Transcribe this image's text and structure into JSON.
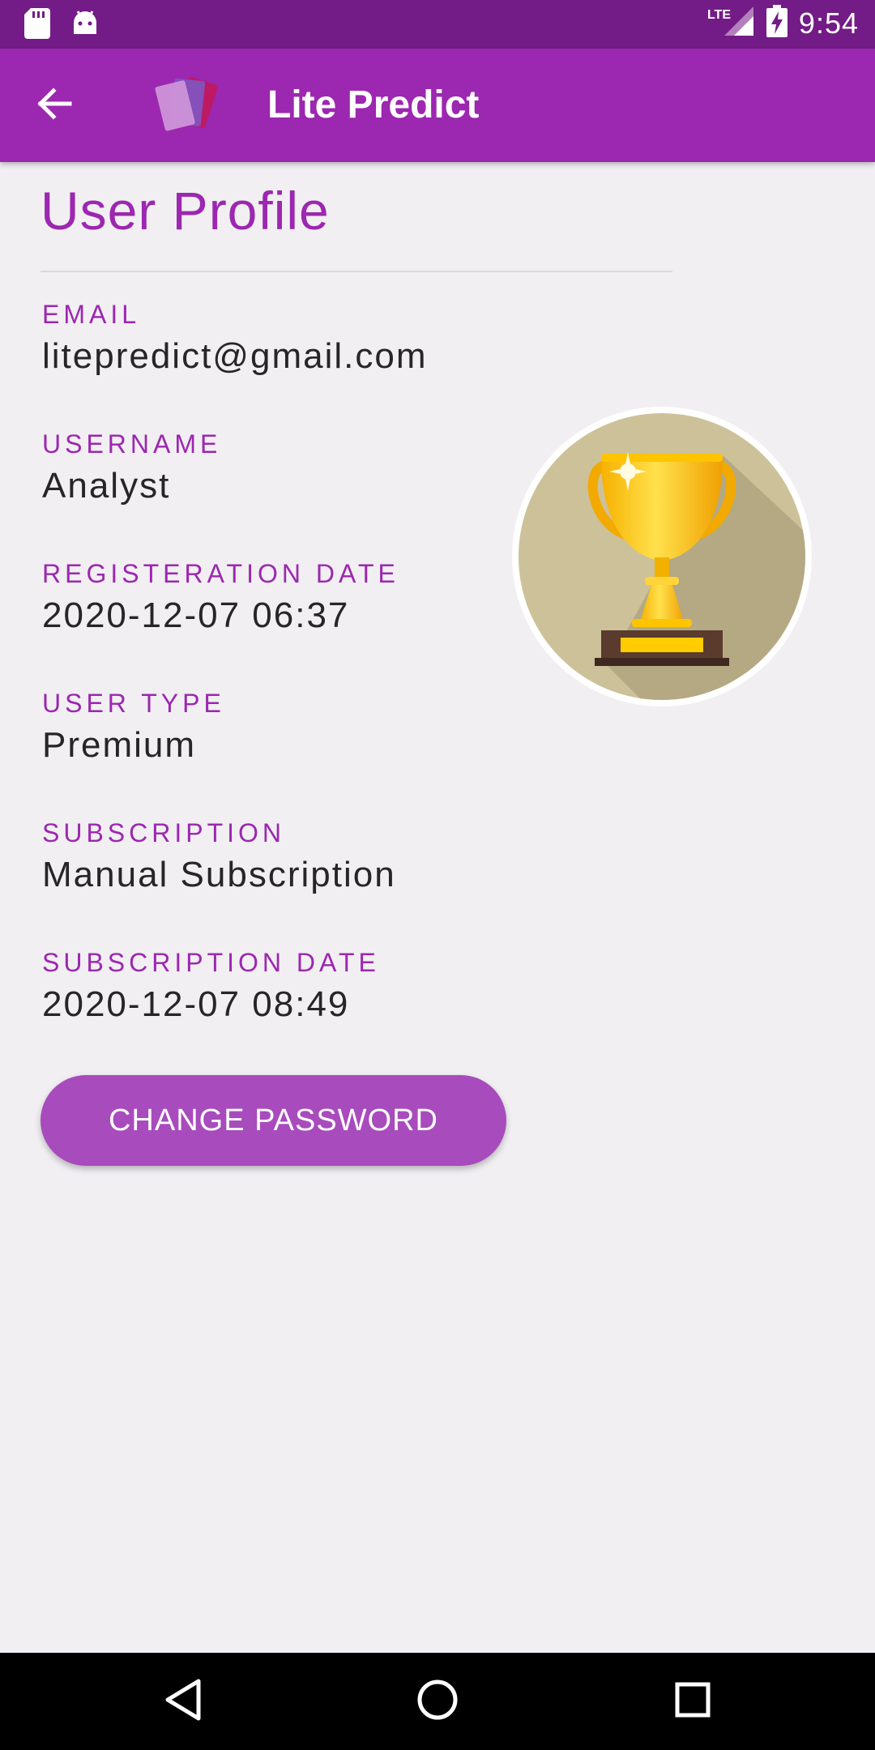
{
  "status_bar": {
    "network": "LTE",
    "time": "9:54",
    "icons": [
      "sd-card-icon",
      "android-icon",
      "lte-signal-icon",
      "battery-charging-icon"
    ]
  },
  "app_bar": {
    "title": "Lite Predict",
    "back_icon": "arrow-back-icon",
    "logo_icon": "app-logo-icon"
  },
  "profile": {
    "title": "User Profile",
    "fields": [
      {
        "label": "EMAIL",
        "value": "litepredict@gmail.com"
      },
      {
        "label": "USERNAME",
        "value": "Analyst"
      },
      {
        "label": "REGISTERATION DATE",
        "value": "2020-12-07 06:37"
      },
      {
        "label": "USER TYPE",
        "value": "Premium"
      },
      {
        "label": "SUBSCRIPTION",
        "value": "Manual Subscription"
      },
      {
        "label": "SUBSCRIPTION DATE",
        "value": "2020-12-07 08:49"
      }
    ],
    "avatar_icon": "trophy-icon",
    "change_password_label": "CHANGE PASSWORD"
  },
  "nav_bar": {
    "icons": [
      "nav-back-icon",
      "nav-home-icon",
      "nav-recents-icon"
    ]
  },
  "colors": {
    "status_bar": "#731b86",
    "primary": "#9c27b0",
    "button": "#a84bbd",
    "background": "#f1eff2",
    "text": "#262626"
  }
}
